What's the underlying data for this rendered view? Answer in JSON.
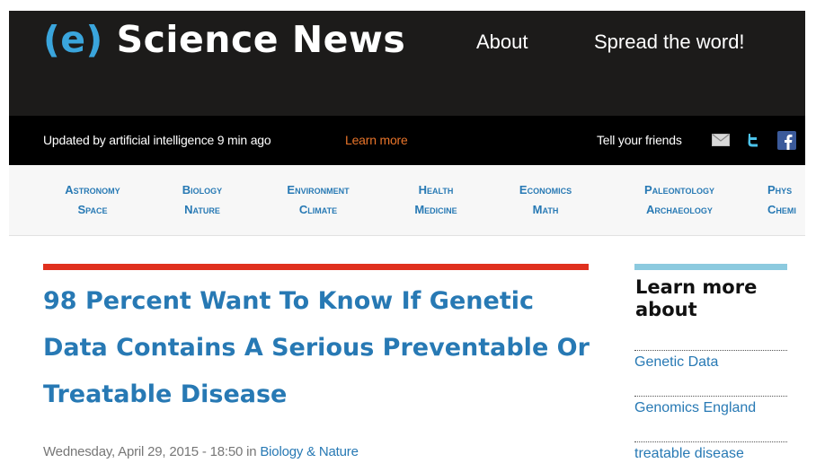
{
  "header": {
    "logo_mark": "(e)",
    "logo_text": "Science News",
    "nav": [
      {
        "label": "About"
      },
      {
        "label": "Spread the word!"
      }
    ]
  },
  "status_bar": {
    "updated_text": "Updated by artificial intelligence 9 min ago",
    "learn_more": "Learn more",
    "tell_friends": "Tell your friends",
    "icons": [
      "mail-icon",
      "twitter-icon",
      "facebook-icon"
    ]
  },
  "categories": [
    {
      "line1": "Astronomy",
      "line2": "Space"
    },
    {
      "line1": "Biology",
      "line2": "Nature"
    },
    {
      "line1": "Environment",
      "line2": "Climate"
    },
    {
      "line1": "Health",
      "line2": "Medicine"
    },
    {
      "line1": "Economics",
      "line2": "Math"
    },
    {
      "line1": "Paleontology",
      "line2": "Archaeology"
    },
    {
      "line1": "Phys",
      "line2": "Chemi"
    }
  ],
  "article": {
    "headline": "98 Percent Want To Know If Genetic Data Contains A Serious Preventable Or Treatable Disease",
    "date": "Wednesday, April 29, 2015 - 18:50 in ",
    "category_link": "Biology & Nature"
  },
  "sidebar": {
    "title": "Learn more about",
    "items": [
      {
        "label": "Genetic Data"
      },
      {
        "label": "Genomics England"
      },
      {
        "label": "treatable disease"
      }
    ]
  },
  "colors": {
    "brand_blue": "#2779b4",
    "logo_blue": "#3aa5dc",
    "accent_red": "#e0301e",
    "learn_more_orange": "#e8742a",
    "sidebar_rule": "#8ccadf"
  }
}
